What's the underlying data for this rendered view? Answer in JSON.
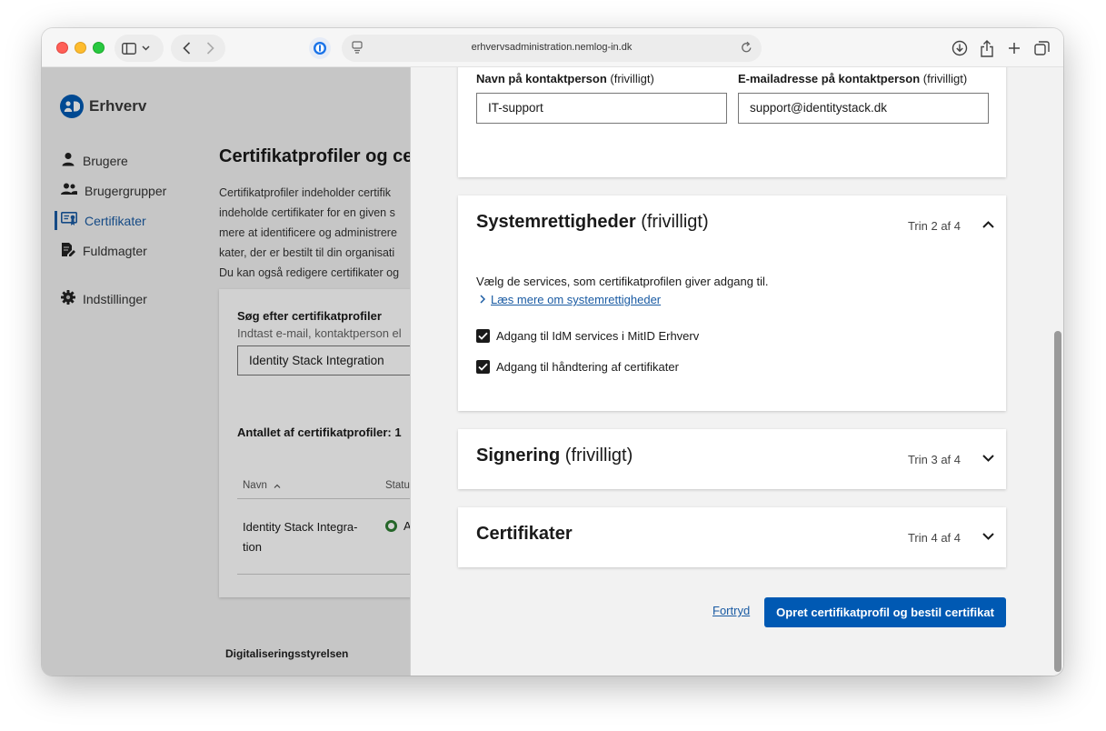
{
  "browser": {
    "url": "erhvervsadministration.nemlog-in.dk"
  },
  "app": {
    "logo_text": "Erhverv",
    "footer": "Digitaliseringsstyrelsen"
  },
  "sidebar": {
    "items": [
      {
        "label": "Brugere",
        "icon": "person-icon"
      },
      {
        "label": "Brugergrupper",
        "icon": "people-icon"
      },
      {
        "label": "Certifikater",
        "icon": "certificate-icon",
        "active": true
      },
      {
        "label": "Fuldmagter",
        "icon": "document-edit-icon"
      },
      {
        "label": "Indstillinger",
        "icon": "gear-icon"
      }
    ]
  },
  "page": {
    "title": "Certifikatprofiler og cer",
    "description_lines": [
      "Certifikatprofiler indeholder certifik",
      "indeholde certifikater for en given s",
      "mere at identificere og administrere",
      "kater, der er bestilt til din organisati",
      "Du kan også redigere certifikater og"
    ],
    "search": {
      "label": "Søg efter certifikatprofiler",
      "hint": "Indtast e-mail, kontaktperson el",
      "value": "Identity Stack Integration"
    },
    "count_label": "Antallet af certifikatprofiler: 1",
    "table": {
      "columns": [
        "Navn",
        "Statu"
      ],
      "rows": [
        {
          "name": "Identity Stack Integra-tion",
          "status": "A"
        }
      ]
    }
  },
  "drawer": {
    "contact": {
      "name_label": "Navn på kontaktperson",
      "name_optional": "(frivilligt)",
      "name_value": "IT-support",
      "email_label": "E-mailadresse på kontaktperson",
      "email_optional": "(frivilligt)",
      "email_value": "support@identitystack.dk"
    },
    "system_rights": {
      "title": "Systemrettigheder",
      "optional": "(frivilligt)",
      "step": "Trin 2 af 4",
      "description": "Vælg de services, som certifikatprofilen giver adgang til.",
      "read_more": "Læs mere om systemrettigheder",
      "checkboxes": [
        {
          "label": "Adgang til IdM services i MitID Erhverv",
          "checked": true
        },
        {
          "label": "Adgang til håndtering af certifikater",
          "checked": true
        }
      ]
    },
    "signing": {
      "title": "Signering",
      "optional": "(frivilligt)",
      "step": "Trin 3 af 4"
    },
    "certificates": {
      "title": "Certifikater",
      "step": "Trin 4 af 4"
    },
    "cancel_label": "Fortryd",
    "submit_label": "Opret certifikatprofil og bestil certifikat"
  }
}
